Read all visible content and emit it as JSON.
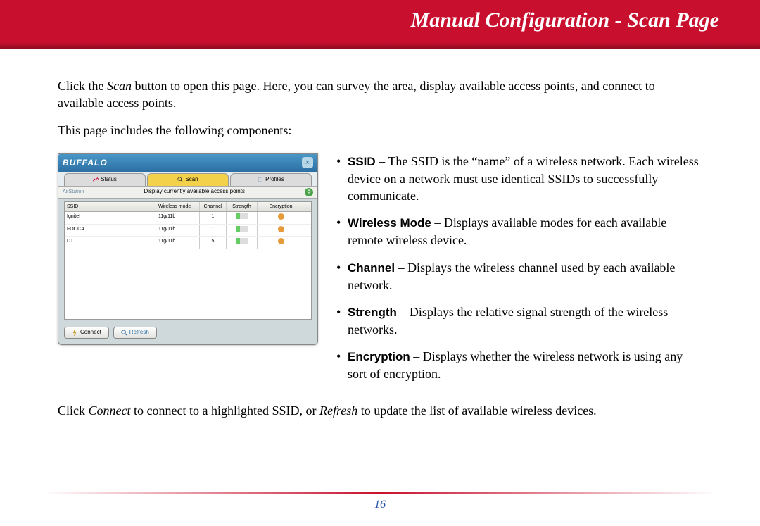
{
  "header": {
    "title": "Manual Configuration - Scan Page"
  },
  "intro": {
    "p1a": "Click the ",
    "p1_scan": "Scan",
    "p1b": " button to open this page. Here, you can survey the area, display available access points, and connect to available access points.",
    "p2": "This page includes the following components:"
  },
  "screenshot": {
    "brand": "BUFFALO",
    "close": "×",
    "tabs": {
      "status": "Status",
      "scan": "Scan",
      "profiles": "Profiles"
    },
    "app": "AirStation",
    "sub": "Display currently available access points",
    "help": "?",
    "headers": {
      "ssid": "SSID",
      "mode": "Wireless mode",
      "channel": "Channel",
      "strength": "Strength",
      "encryption": "Encryption"
    },
    "rows": [
      {
        "ssid": "Ignite!",
        "mode": "11g/11b",
        "ch": "1"
      },
      {
        "ssid": "FOOCA",
        "mode": "11g/11b",
        "ch": "1"
      },
      {
        "ssid": "DT",
        "mode": "11g/11b",
        "ch": "5"
      }
    ],
    "connect": "Connect",
    "refresh": "Refresh"
  },
  "bullets": [
    {
      "term": "SSID",
      "desc": " – The SSID is the “name” of a wireless network. Each wireless device on a network must use identical SSIDs to successfully communicate."
    },
    {
      "term": "Wireless Mode",
      "desc": " – Displays available modes for each available remote wireless device."
    },
    {
      "term": "Channel",
      "desc": " – Displays the wireless channel used by each available network."
    },
    {
      "term": "Strength",
      "desc": " – Displays the relative signal strength of the wireless networks."
    },
    {
      "term": "Encryption",
      "desc": " – Displays whether the wireless network is using any sort of encryption."
    }
  ],
  "outro": {
    "a": "Click ",
    "connect": "Connect",
    "b": " to connect to a highlighted SSID, or ",
    "refresh": "Refresh",
    "c": " to update the list of available wireless devices."
  },
  "page_number": "16"
}
